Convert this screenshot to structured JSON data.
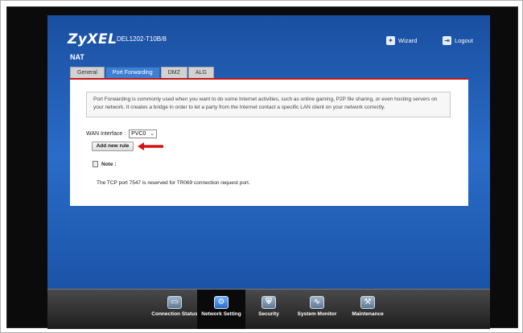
{
  "header": {
    "logo": "ZyXEL",
    "model": "DEL1202-T10B/8",
    "wizard_label": "Wizard",
    "logout_label": "Logout"
  },
  "section_title": "NAT",
  "tabs": [
    {
      "label": "General",
      "active": false
    },
    {
      "label": "Port Forwarding",
      "active": true
    },
    {
      "label": "DMZ",
      "active": false
    },
    {
      "label": "ALG",
      "active": false
    }
  ],
  "info_text": "Port Forwarding is commonly used when you want to do some Internet activities, such as online gaming, P2P file sharing, or even hosting servers on your network. It creates a bridge in order to let a party from the Internet contact a specific LAN client on your network correctly.",
  "wan": {
    "label": "WAN Interface :",
    "selected": "PVC0"
  },
  "add_rule_label": "Add new rule",
  "note": {
    "title": "Note :",
    "text": "The TCP port 7547 is reserved for TR069 connection request port."
  },
  "bottom_nav": [
    {
      "label": "Connection Status",
      "icon": "monitor-icon",
      "active": false
    },
    {
      "label": "Network Setting",
      "icon": "gear-icon",
      "active": true
    },
    {
      "label": "Security",
      "icon": "shield-icon",
      "active": false
    },
    {
      "label": "System Monitor",
      "icon": "chart-icon",
      "active": false
    },
    {
      "label": "Maintenance",
      "icon": "tools-icon",
      "active": false
    }
  ],
  "colors": {
    "accent_red": "#c01818",
    "header_blue": "#1a4fa0",
    "active_tab": "#3d7fd4"
  }
}
